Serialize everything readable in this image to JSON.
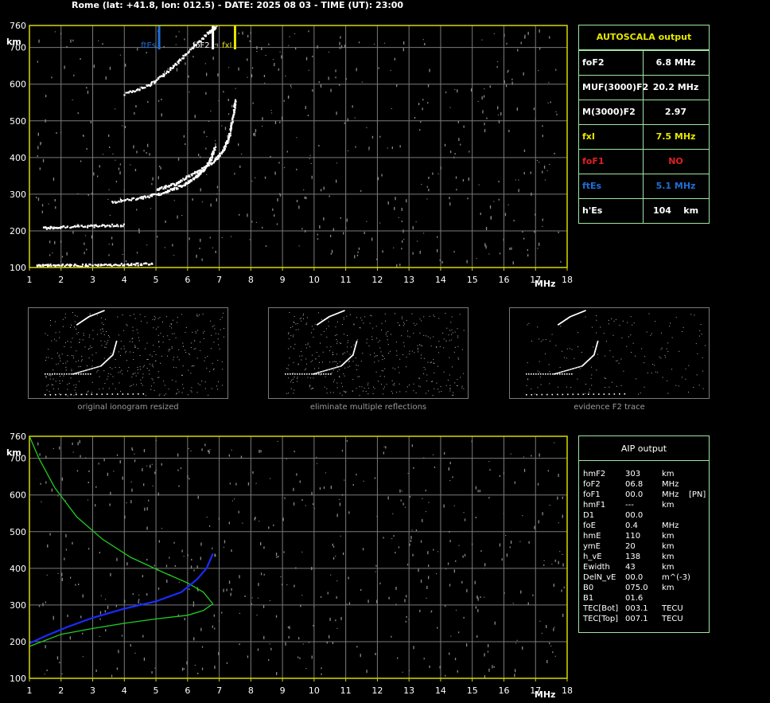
{
  "header": "Rome (lat: +41.8, lon: 012.5) - DATE: 2025 08 03 - TIME (UT): 23:00",
  "colors": {
    "frame": "#d8d800",
    "grid": "#7a7a7a",
    "box": "#9fe79f",
    "ftEs": "#1e6fd9",
    "fxI": "#e6e600",
    "foF1": "#e02020",
    "profile": "#22cc22",
    "trace": "#1a2cff"
  },
  "chart_data": [
    {
      "type": "scatter",
      "name": "ionogram",
      "xlabel": "MHz",
      "ylabel": "km",
      "xlim": [
        1,
        18
      ],
      "ylim": [
        100,
        760
      ],
      "x_ticks": [
        "1",
        "2",
        "3",
        "4",
        "5",
        "6",
        "7",
        "8",
        "9",
        "10",
        "11",
        "12",
        "13",
        "14",
        "15",
        "16",
        "17",
        "18"
      ],
      "y_ticks": [
        "100",
        "200",
        "300",
        "400",
        "500",
        "600",
        "700",
        "760"
      ],
      "markers": [
        {
          "label": "ftEs",
          "x": 5.1,
          "color": "#1e6fd9"
        },
        {
          "label": "foF2",
          "x": 6.8,
          "color": "#ffffff"
        },
        {
          "label": "fxI",
          "x": 7.5,
          "color": "#e6e600"
        }
      ],
      "traces": [
        {
          "name": "Es-100",
          "points": [
            [
              1.2,
              108
            ],
            [
              2.0,
              108
            ],
            [
              3.0,
              108
            ],
            [
              4.0,
              110
            ],
            [
              4.9,
              112
            ]
          ]
        },
        {
          "name": "Es-200",
          "points": [
            [
              1.4,
              210
            ],
            [
              2.0,
              213
            ],
            [
              3.0,
              215
            ],
            [
              4.0,
              218
            ]
          ]
        },
        {
          "name": "F2-o",
          "points": [
            [
              3.6,
              280
            ],
            [
              4.5,
              292
            ],
            [
              5.2,
              305
            ],
            [
              5.8,
              325
            ],
            [
              6.2,
              345
            ],
            [
              6.5,
              370
            ],
            [
              6.7,
              395
            ],
            [
              6.85,
              430
            ]
          ]
        },
        {
          "name": "F2-x",
          "points": [
            [
              5.0,
              315
            ],
            [
              5.6,
              330
            ],
            [
              6.2,
              360
            ],
            [
              6.8,
              390
            ],
            [
              7.1,
              420
            ],
            [
              7.3,
              460
            ],
            [
              7.4,
              510
            ],
            [
              7.5,
              560
            ]
          ]
        },
        {
          "name": "F2-mult",
          "points": [
            [
              4.0,
              575
            ],
            [
              4.8,
              600
            ],
            [
              5.4,
              640
            ],
            [
              6.0,
              690
            ],
            [
              6.6,
              740
            ],
            [
              6.9,
              760
            ]
          ]
        }
      ]
    },
    {
      "type": "line",
      "name": "aip",
      "xlabel": "MHz",
      "ylabel": "km",
      "xlim": [
        1,
        18
      ],
      "ylim": [
        100,
        760
      ],
      "x_ticks": [
        "1",
        "2",
        "3",
        "4",
        "5",
        "6",
        "7",
        "8",
        "9",
        "10",
        "11",
        "12",
        "13",
        "14",
        "15",
        "16",
        "17",
        "18"
      ],
      "y_ticks": [
        "100",
        "200",
        "300",
        "400",
        "500",
        "600",
        "700",
        "760"
      ],
      "series": [
        {
          "points": [
            [
              1.0,
              760
            ],
            [
              1.3,
              700
            ],
            [
              1.8,
              620
            ],
            [
              2.5,
              540
            ],
            [
              3.3,
              480
            ],
            [
              4.2,
              430
            ],
            [
              5.2,
              390
            ],
            [
              6.0,
              360
            ],
            [
              6.5,
              335
            ],
            [
              6.8,
              303
            ]
          ],
          "color": "#22cc22"
        },
        {
          "points": [
            [
              6.8,
              303
            ],
            [
              6.5,
              285
            ],
            [
              6.0,
              272
            ],
            [
              5.0,
              262
            ],
            [
              4.0,
              250
            ],
            [
              3.0,
              236
            ],
            [
              2.0,
              220
            ],
            [
              1.0,
              187
            ]
          ],
          "color": "#22cc22"
        },
        {
          "points": [
            [
              1.0,
              195
            ],
            [
              1.5,
              215
            ],
            [
              2.2,
              240
            ],
            [
              3.0,
              265
            ],
            [
              4.0,
              290
            ],
            [
              5.0,
              310
            ],
            [
              5.8,
              335
            ],
            [
              6.3,
              370
            ],
            [
              6.6,
              400
            ],
            [
              6.8,
              440
            ]
          ],
          "color": "#1a2cff"
        }
      ]
    }
  ],
  "autoscala": {
    "title": "AUTOSCALA output",
    "rows": [
      {
        "label": "foF2",
        "value": "6.8 MHz",
        "lc": "#ffffff",
        "vc": "#ffffff"
      },
      {
        "label": "MUF(3000)F2",
        "value": "20.2 MHz",
        "lc": "#ffffff",
        "vc": "#ffffff"
      },
      {
        "label": "M(3000)F2",
        "value": "2.97",
        "lc": "#ffffff",
        "vc": "#ffffff"
      },
      {
        "label": "fxI",
        "value": "7.5 MHz",
        "lc": "#e6e600",
        "vc": "#e6e600"
      },
      {
        "label": "foF1",
        "value": "NO",
        "lc": "#e02020",
        "vc": "#e02020"
      },
      {
        "label": "ftEs",
        "value": "5.1 MHz",
        "lc": "#1e6fd9",
        "vc": "#1e6fd9"
      },
      {
        "label": "h'Es",
        "value": "104    km",
        "lc": "#ffffff",
        "vc": "#ffffff"
      }
    ]
  },
  "thumbnails": [
    "original ionogram resized",
    "eliminate multiple reflections",
    "evidence F2 trace"
  ],
  "aip": {
    "title": "AIP output",
    "rows": [
      [
        "hmF2",
        "303",
        "km",
        ""
      ],
      [
        "foF2",
        "06.8",
        "MHz",
        ""
      ],
      [
        "foF1",
        "00.0",
        "MHz",
        "[PN]"
      ],
      [
        "hmF1",
        "---",
        "km",
        ""
      ],
      [
        "D1",
        "00.0",
        "",
        ""
      ],
      [
        "foE",
        "0.4",
        "MHz",
        ""
      ],
      [
        "hmE",
        "110",
        "km",
        ""
      ],
      [
        "ymE",
        "20",
        "km",
        ""
      ],
      [
        "h_vE",
        "138",
        "km",
        ""
      ],
      [
        "Ewidth",
        "43",
        "km",
        ""
      ],
      [
        "DelN_vE",
        "00.0",
        "m^(-3)",
        ""
      ],
      [
        "B0",
        "075.0",
        "km",
        ""
      ],
      [
        "B1",
        "01.6",
        "",
        ""
      ],
      [
        "TEC[Bot]",
        "003.1",
        "TECU",
        ""
      ],
      [
        "TEC[Top]",
        "007.1",
        "TECU",
        ""
      ]
    ]
  }
}
